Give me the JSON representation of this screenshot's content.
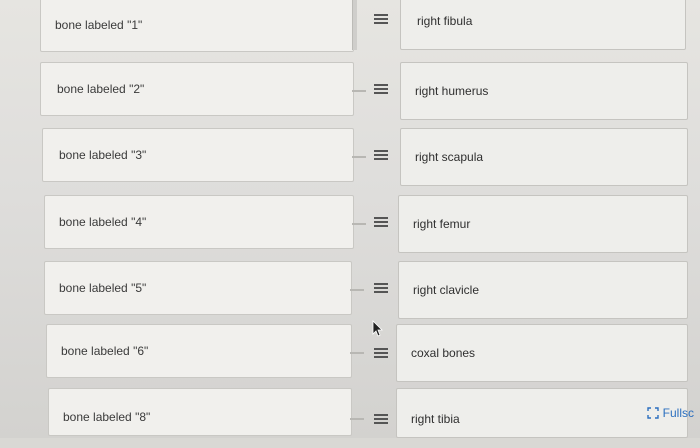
{
  "matching": {
    "rows": [
      {
        "left_label": "bone labeled \"1\"",
        "right_label": "right fibula"
      },
      {
        "left_label": "bone labeled \"2\"",
        "right_label": "right humerus"
      },
      {
        "left_label": "bone labeled \"3\"",
        "right_label": "right scapula"
      },
      {
        "left_label": "bone labeled \"4\"",
        "right_label": "right femur"
      },
      {
        "left_label": "bone labeled \"5\"",
        "right_label": "right clavicle"
      },
      {
        "left_label": "bone labeled \"6\"",
        "right_label": "coxal bones"
      },
      {
        "left_label": "bone labeled \"8\"",
        "right_label": "right tibia"
      }
    ]
  },
  "fullscreen": {
    "label": "Fullsc",
    "icon": "fullscreen-icon"
  },
  "icons": {
    "drag": "drag-handle-icon",
    "cursor": "pointer-cursor-icon"
  },
  "colors": {
    "link": "#2b6fbf",
    "card": "#f1f0ed",
    "border": "#c9c8c4"
  }
}
